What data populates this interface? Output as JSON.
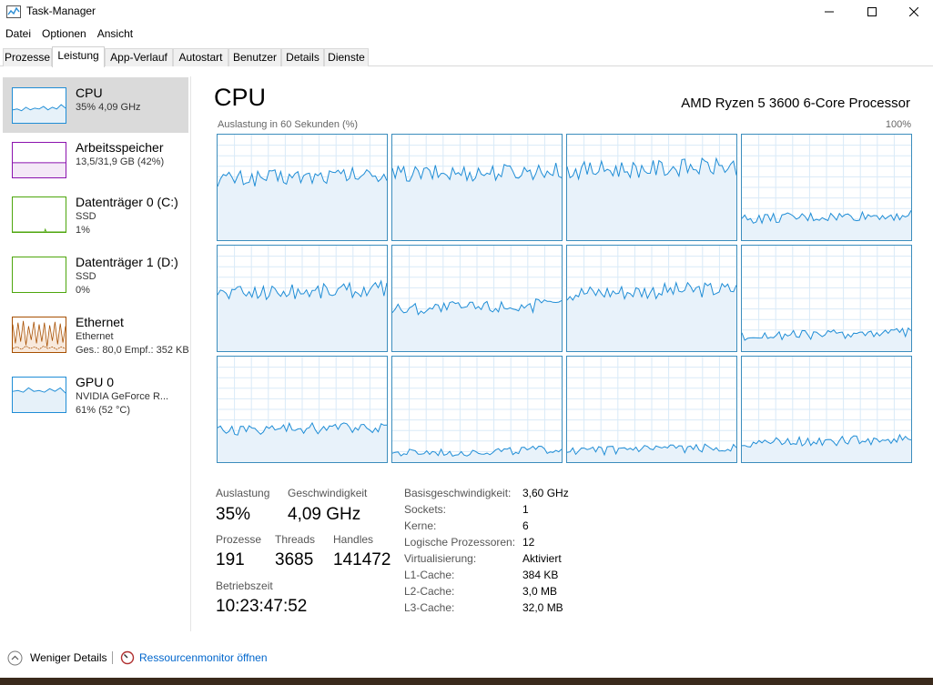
{
  "window": {
    "title": "Task-Manager"
  },
  "menu": [
    "Datei",
    "Optionen",
    "Ansicht"
  ],
  "tabs": [
    "Prozesse",
    "Leistung",
    "App-Verlauf",
    "Autostart",
    "Benutzer",
    "Details",
    "Dienste"
  ],
  "active_tab": "Leistung",
  "sidebar": [
    {
      "name": "CPU",
      "lines": [
        "35%  4,09 GHz"
      ]
    },
    {
      "name": "Arbeitsspeicher",
      "lines": [
        "13,5/31,9 GB (42%)"
      ]
    },
    {
      "name": "Datenträger 0 (C:)",
      "lines": [
        "SSD",
        "1%"
      ]
    },
    {
      "name": "Datenträger 1 (D:)",
      "lines": [
        "SSD",
        "0%"
      ]
    },
    {
      "name": "Ethernet",
      "lines": [
        "Ethernet",
        "Ges.: 80,0  Empf.: 352 KB"
      ]
    },
    {
      "name": "GPU 0",
      "lines": [
        "NVIDIA GeForce R...",
        "61%  (52 °C)"
      ]
    }
  ],
  "main": {
    "title": "CPU",
    "processor": "AMD Ryzen 5 3600 6-Core Processor",
    "graph_label": "Auslastung in 60 Sekunden (%)",
    "graph_max": "100%",
    "core_levels": [
      0.58,
      0.62,
      0.66,
      0.2,
      0.55,
      0.4,
      0.55,
      0.14,
      0.3,
      0.08,
      0.1,
      0.18
    ]
  },
  "stats": {
    "auslastung_label": "Auslastung",
    "auslastung": "35%",
    "geschwindigkeit_label": "Geschwindigkeit",
    "geschwindigkeit": "4,09 GHz",
    "prozesse_label": "Prozesse",
    "prozesse": "191",
    "threads_label": "Threads",
    "threads": "3685",
    "handles_label": "Handles",
    "handles": "141472",
    "betriebszeit_label": "Betriebszeit",
    "betriebszeit": "10:23:47:52"
  },
  "details": [
    {
      "key": "Basisgeschwindigkeit:",
      "value": "3,60 GHz"
    },
    {
      "key": "Sockets:",
      "value": "1"
    },
    {
      "key": "Kerne:",
      "value": "6"
    },
    {
      "key": "Logische Prozessoren:",
      "value": "12"
    },
    {
      "key": "Virtualisierung:",
      "value": "Aktiviert"
    },
    {
      "key": "L1-Cache:",
      "value": "384 KB"
    },
    {
      "key": "L2-Cache:",
      "value": "3,0 MB"
    },
    {
      "key": "L3-Cache:",
      "value": "32,0 MB"
    }
  ],
  "footer": {
    "less_details": "Weniger Details",
    "resource_monitor": "Ressourcenmonitor öffnen"
  },
  "colors": {
    "cpu": "#1f8dd6",
    "memory": "#8b12ae",
    "disk": "#4da60c",
    "ethernet": "#a74f01",
    "gpu": "#1f8dd6"
  }
}
